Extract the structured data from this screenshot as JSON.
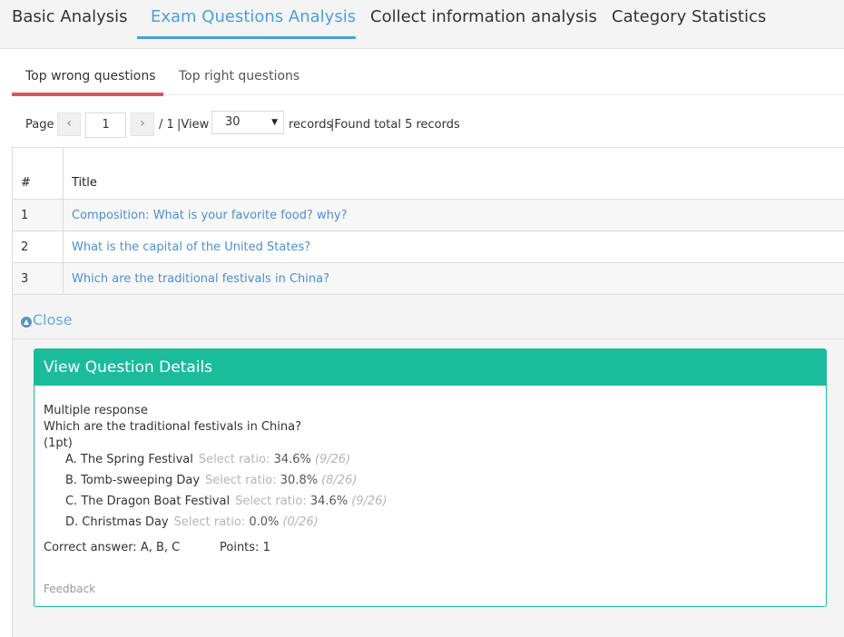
{
  "top_tabs": [
    {
      "label": "Basic Analysis"
    },
    {
      "label": "Exam Questions Analysis"
    },
    {
      "label": "Collect information analysis"
    },
    {
      "label": "Category Statistics"
    }
  ],
  "sub_tabs": [
    {
      "label": "Top wrong questions"
    },
    {
      "label": "Top right questions"
    }
  ],
  "pager": {
    "page_label": "Page",
    "prev_icon": "‹",
    "next_icon": "›",
    "page_value": "1",
    "of_total": "/ 1",
    "view_label": "|View",
    "per_page": "30",
    "records_label": "records",
    "found_label": "|Found total 5 records"
  },
  "table": {
    "headers": {
      "num": "#",
      "title": "Title"
    },
    "rows": [
      {
        "num": "1",
        "title": "Composition: What is your favorite food? why?"
      },
      {
        "num": "2",
        "title": "What is the capital of the United States?"
      },
      {
        "num": "3",
        "title": "Which are the traditional festivals in China?"
      }
    ]
  },
  "detail": {
    "close_label": "Close",
    "card_title": "View Question Details",
    "type": "Multiple response",
    "question": "Which are the traditional festivals in China?",
    "points_hint": "(1pt)",
    "ratio_label": "Select ratio:",
    "options": [
      {
        "label": "A. The Spring Festival",
        "ratio": "34.6%",
        "frac": "(9/26)"
      },
      {
        "label": "B. Tomb-sweeping Day",
        "ratio": "30.8%",
        "frac": "(8/26)"
      },
      {
        "label": "C. The Dragon Boat Festival",
        "ratio": "34.6%",
        "frac": "(9/26)"
      },
      {
        "label": "D. Christmas Day",
        "ratio": "0.0%",
        "frac": "(0/26)"
      }
    ],
    "correct_answer": "Correct answer: A, B, C",
    "points": "Points: 1",
    "feedback": "Feedback"
  },
  "colors": {
    "accent_blue": "#4a9fe0",
    "sub_tab_red": "#e0535f",
    "card_green": "#1abc9c",
    "link_blue": "#4d8fd1"
  }
}
